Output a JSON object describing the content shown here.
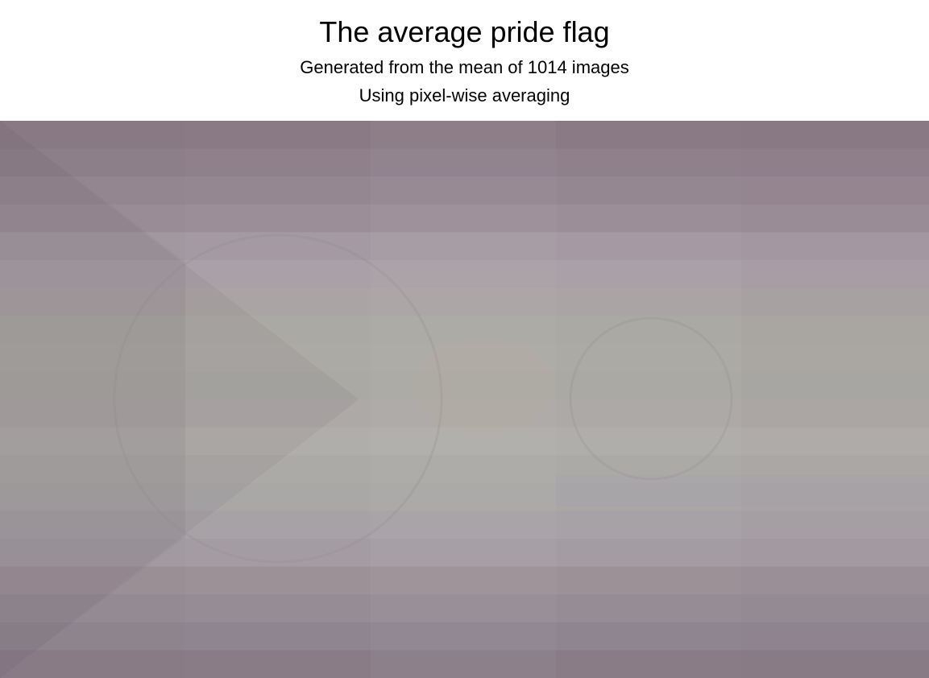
{
  "header": {
    "title": "The average pride flag",
    "subtitle_line1": "Generated from the mean of 1014 images",
    "subtitle_line2": "Using pixel-wise averaging"
  },
  "image": {
    "description_name": "averaged-pride-flag",
    "band_colors": [
      "#8a7a85",
      "#8f808b",
      "#958792",
      "#9b8e98",
      "#a59aa3",
      "#aaa0a7",
      "#aaa4a4",
      "#aba9a4",
      "#acaaa5",
      "#aaa9a4",
      "#ada9a6",
      "#b0aeab",
      "#acaaa7",
      "#aaa7a7",
      "#a7a2a6",
      "#a49ca3",
      "#9d9198",
      "#958c95",
      "#8f8590",
      "#897c87"
    ],
    "triangle_tint": "#6e6470",
    "circle_tint": "#8f8a8c"
  }
}
